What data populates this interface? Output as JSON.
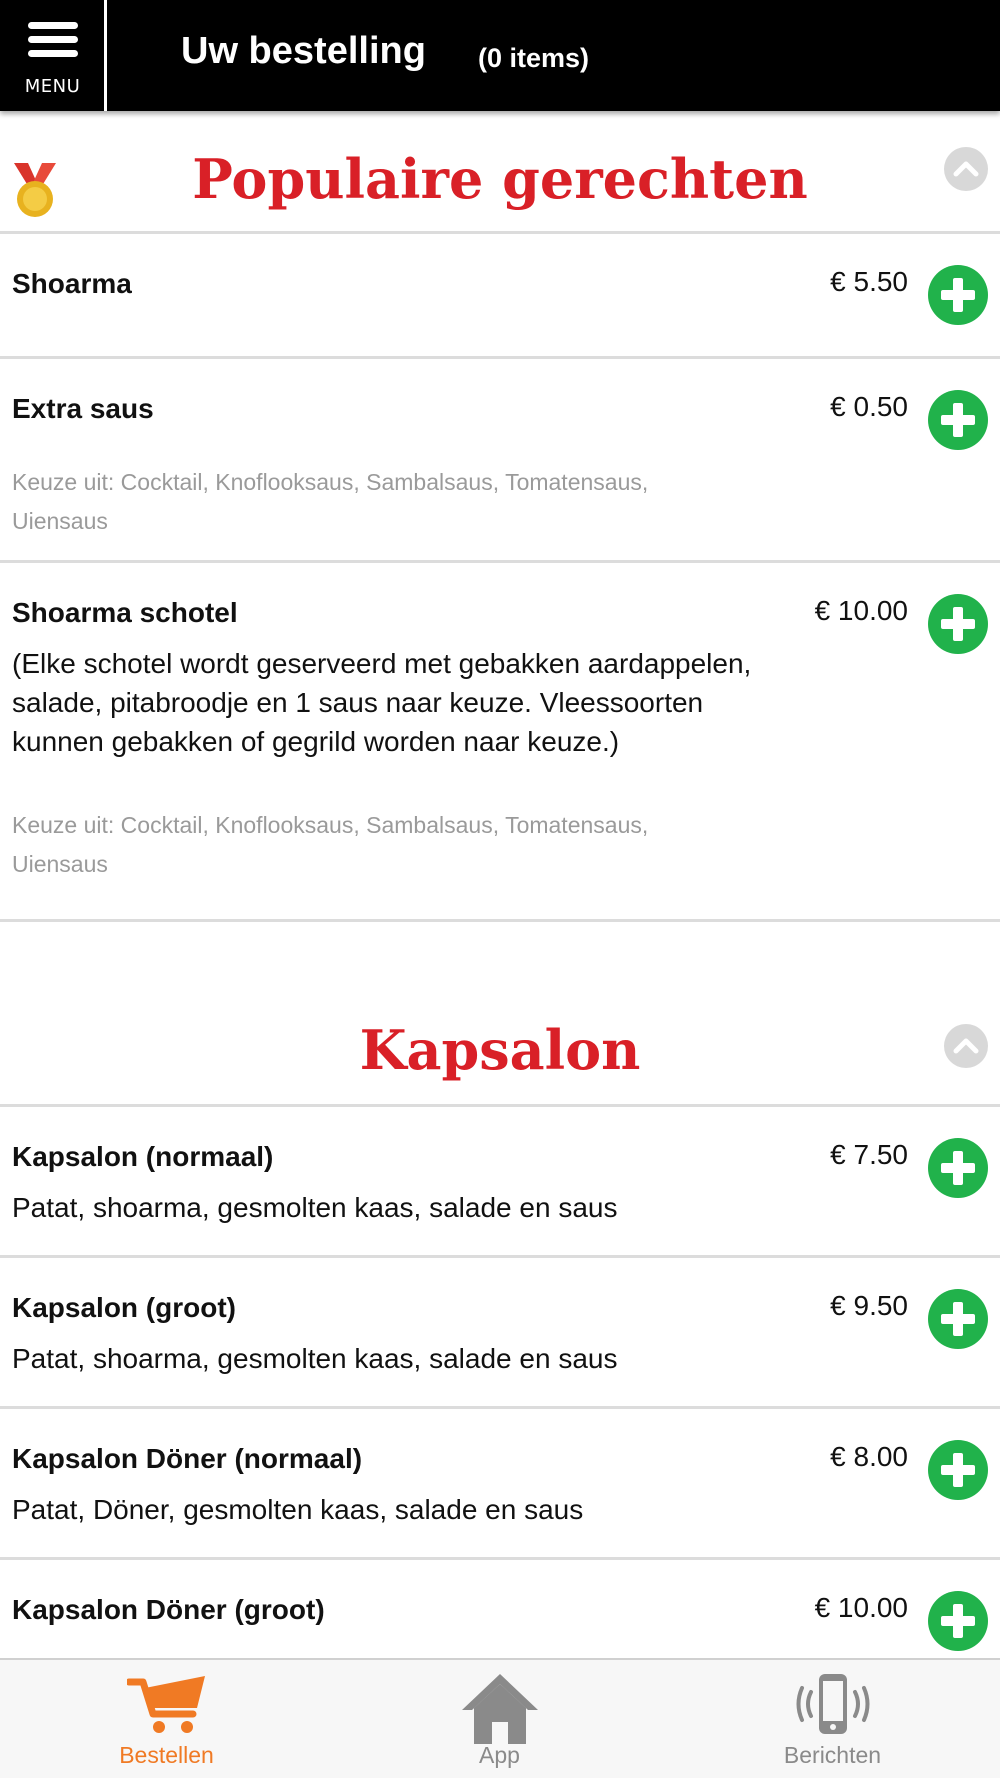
{
  "header": {
    "menu_label": "MENU",
    "title": "Uw bestelling",
    "count": "(0 items)"
  },
  "colors": {
    "accent_red": "#d92027",
    "add_green": "#21b24b",
    "tab_active_orange": "#f07a24",
    "tab_inactive_gray": "#8a8a8a"
  },
  "sections": [
    {
      "title": "Populaire gerechten",
      "icon": "medal-icon",
      "items": [
        {
          "name": "Shoarma",
          "price": "€ 5.50"
        },
        {
          "name": "Extra saus",
          "price": "€ 0.50",
          "options": "Keuze uit: Cocktail, Knoflooksaus, Sambalsaus, Tomatensaus, Uiensaus"
        },
        {
          "name": "Shoarma schotel",
          "price": "€ 10.00",
          "description": "(Elke schotel wordt geserveerd met gebakken aardappelen, salade, pitabroodje en 1 saus naar keuze. Vleessoorten kunnen gebakken of gegrild worden naar keuze.)",
          "options": "Keuze uit: Cocktail, Knoflooksaus, Sambalsaus, Tomatensaus, Uiensaus"
        }
      ]
    },
    {
      "title": "Kapsalon",
      "items": [
        {
          "name": "Kapsalon (normaal)",
          "price": "€ 7.50",
          "description": "Patat, shoarma, gesmolten kaas, salade en saus"
        },
        {
          "name": "Kapsalon (groot)",
          "price": "€ 9.50",
          "description": "Patat, shoarma, gesmolten kaas, salade en saus"
        },
        {
          "name": "Kapsalon Döner (normaal)",
          "price": "€ 8.00",
          "description": "Patat, Döner, gesmolten kaas, salade en saus"
        },
        {
          "name": "Kapsalon Döner (groot)",
          "price": "€ 10.00"
        }
      ]
    }
  ],
  "tabs": [
    {
      "label": "Bestellen",
      "icon": "cart-icon",
      "active": true
    },
    {
      "label": "App",
      "icon": "home-icon",
      "active": false
    },
    {
      "label": "Berichten",
      "icon": "phone-vibrate-icon",
      "active": false
    }
  ]
}
